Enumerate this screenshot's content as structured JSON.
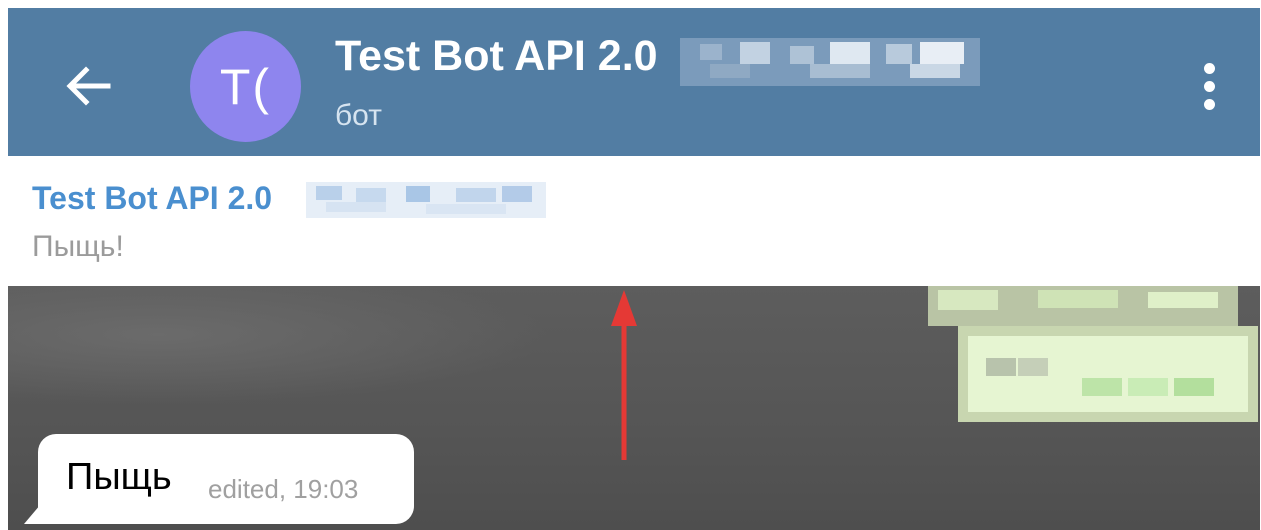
{
  "header": {
    "avatar_initials": "T(",
    "title": "Test Bot API 2.0",
    "subtitle": "бот",
    "avatar_color": "#8e85ee",
    "bar_color": "#527da3",
    "back_icon": "arrow-left-icon",
    "menu_icon": "more-vertical-icon"
  },
  "pinned": {
    "title": "Test Bot API 2.0",
    "text": "Пыщь!"
  },
  "chat": {
    "messages": [
      {
        "text": "Пыщь",
        "meta": "edited, 19:03"
      }
    ]
  },
  "annotation": {
    "color": "#e53935",
    "type": "arrow-up"
  }
}
